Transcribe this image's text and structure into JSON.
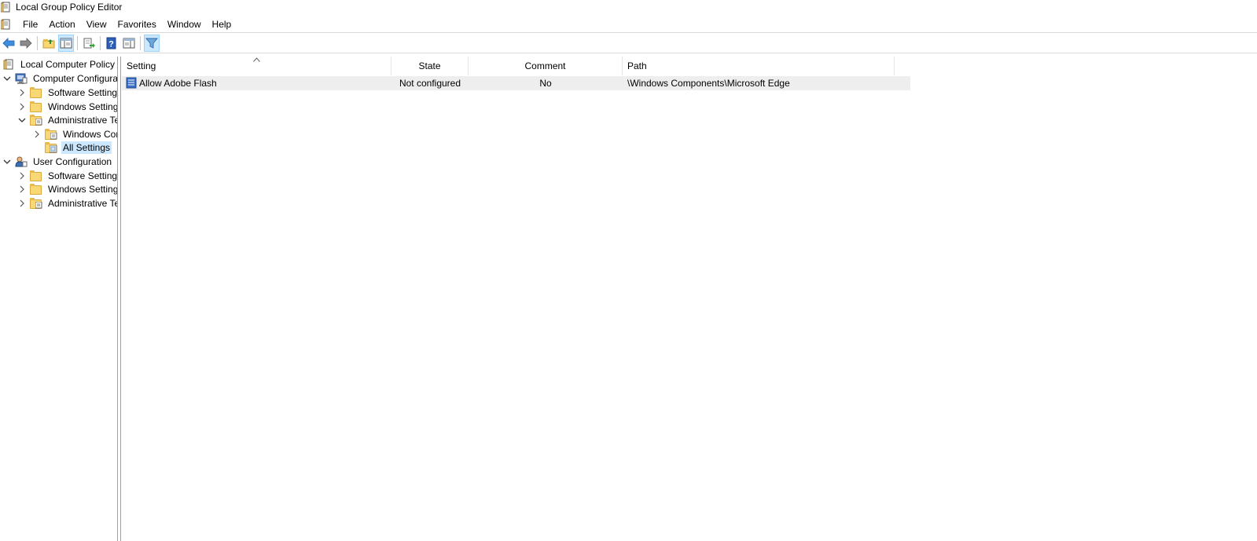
{
  "window": {
    "title": "Local Group Policy Editor"
  },
  "menu": {
    "items": [
      "File",
      "Action",
      "View",
      "Favorites",
      "Window",
      "Help"
    ]
  },
  "toolbar": {
    "buttons": [
      {
        "name": "back-icon"
      },
      {
        "name": "forward-icon"
      },
      {
        "name": "up-one-level-icon"
      },
      {
        "name": "show-hide-console-tree-icon",
        "pressed": true
      },
      {
        "name": "export-list-icon"
      },
      {
        "name": "help-icon"
      },
      {
        "name": "show-hide-action-pane-icon"
      },
      {
        "name": "filter-icon",
        "pressed": true
      }
    ]
  },
  "tree": {
    "items": [
      {
        "label": "Local Computer Policy",
        "icon": "policy-icon"
      },
      {
        "label": "Computer Configura",
        "icon": "computer-icon",
        "expanded": true
      },
      {
        "label": "Software Settings",
        "icon": "folder-icon"
      },
      {
        "label": "Windows Setting",
        "icon": "folder-icon"
      },
      {
        "label": "Administrative Te",
        "icon": "admin-templates-icon",
        "expanded": true
      },
      {
        "label": "Windows Cor",
        "icon": "admin-templates-icon"
      },
      {
        "label": "All Settings",
        "icon": "all-settings-icon",
        "selected": true
      },
      {
        "label": "User Configuration",
        "icon": "user-icon",
        "expanded": true
      },
      {
        "label": "Software Settings",
        "icon": "folder-icon"
      },
      {
        "label": "Windows Setting",
        "icon": "folder-icon"
      },
      {
        "label": "Administrative Te",
        "icon": "admin-templates-icon"
      }
    ]
  },
  "table": {
    "columns": [
      "Setting",
      "State",
      "Comment",
      "Path"
    ],
    "rows": [
      {
        "setting": "Allow Adobe Flash",
        "state": "Not configured",
        "comment": "No",
        "path": "\\Windows Components\\Microsoft Edge"
      }
    ]
  }
}
